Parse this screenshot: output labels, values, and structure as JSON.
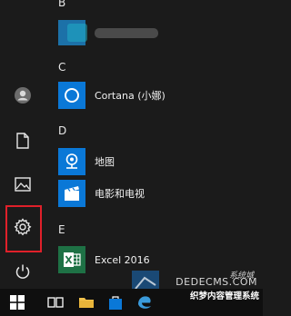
{
  "sections": [
    {
      "letter": "B"
    },
    {
      "letter": "C"
    },
    {
      "letter": "D"
    },
    {
      "letter": "E"
    }
  ],
  "apps": [
    {
      "label": "Cortana (小娜)",
      "icon": "cortana-icon",
      "tile_color": "#0a78d7"
    },
    {
      "label": "地图",
      "icon": "map-pin-icon",
      "tile_color": "#0a78d7"
    },
    {
      "label": "电影和电视",
      "icon": "film-icon",
      "tile_color": "#0a78d7"
    },
    {
      "label": "Excel 2016",
      "icon": "excel-icon",
      "tile_color": "#1e7145"
    }
  ],
  "rail": {
    "items": [
      "user-avatar-icon",
      "document-icon",
      "pictures-icon",
      "settings-gear-icon",
      "power-icon"
    ]
  },
  "taskbar": {
    "items": [
      "windows-start-icon",
      "task-view-icon",
      "file-explorer-icon",
      "store-icon",
      "edge-icon"
    ]
  },
  "watermark": {
    "site": "DEDECMS.COM",
    "brand": "系统城",
    "slogan": "织梦内容管理系统"
  },
  "colors": {
    "accent": "#0a78d7",
    "excel": "#1e7145",
    "highlight": "#e0202a"
  }
}
